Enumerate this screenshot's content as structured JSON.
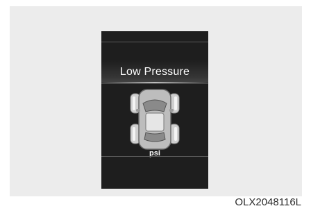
{
  "display": {
    "message": "Low Pressure",
    "unit": "psi",
    "icon": "car-top-view-icon"
  },
  "figure": {
    "code": "OLX2048116L"
  },
  "colors": {
    "screen": "#1e1e1e",
    "panel": "#ececec",
    "text": "#ffffff"
  }
}
